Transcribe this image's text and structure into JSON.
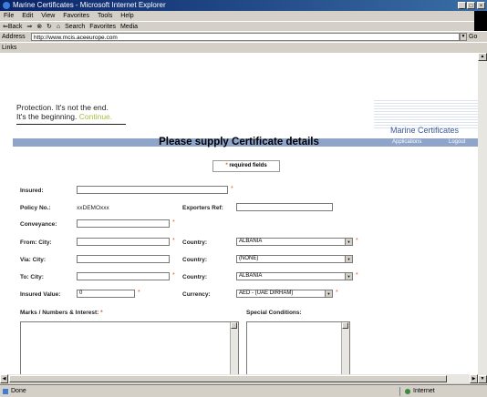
{
  "window": {
    "title": "Marine Certificates - Microsoft Internet Explorer",
    "min": "_",
    "max": "□",
    "close": "×"
  },
  "menu": [
    "File",
    "Edit",
    "View",
    "Favorites",
    "Tools",
    "Help"
  ],
  "toolbar": {
    "back": "⇐Back",
    "forward": "⇒",
    "stop": "⊗",
    "refresh": "↻",
    "home": "⌂",
    "search": "Search",
    "favorites": "Favorites",
    "media": "Media"
  },
  "address": {
    "label": "Address",
    "url": "http://www.mcis.aceeurope.com",
    "go": "Go"
  },
  "links_label": "Links",
  "banner": {
    "line1": "Protection. It's not the end.",
    "line2_a": "It's the beginning.",
    "line2_b": "Continue.",
    "brand": "Marine Certificates",
    "nav_applications": "Applications",
    "nav_logout": "Logout"
  },
  "form": {
    "heading": "Please supply Certificate details",
    "required_note": "required fields",
    "required_star": "*",
    "insured_label": "Insured:",
    "insured_value": "",
    "policy_label": "Policy No.:",
    "policy_value": "xxDEMOxxx",
    "exporters_label": "Exporters Ref:",
    "exporters_value": "",
    "conveyance_label": "Conveyance:",
    "conveyance_value": "",
    "from_city_label": "From: City:",
    "from_city_value": "",
    "from_country_label": "Country:",
    "from_country_value": "ALBANIA",
    "via_city_label": "Via: City:",
    "via_city_value": "",
    "via_country_label": "Country:",
    "via_country_value": "(NONE)",
    "to_city_label": "To: City:",
    "to_city_value": "",
    "to_country_label": "Country:",
    "to_country_value": "ALBANIA",
    "insured_value_label": "Insured Value:",
    "insured_value_value": "0",
    "currency_label": "Currency:",
    "currency_value": "AED - (UAE DIRHAM)",
    "marks_label": "Marks / Numbers & Interest:",
    "special_label": "Special Conditions:"
  },
  "status": {
    "left": "Done",
    "zone": "Internet"
  }
}
